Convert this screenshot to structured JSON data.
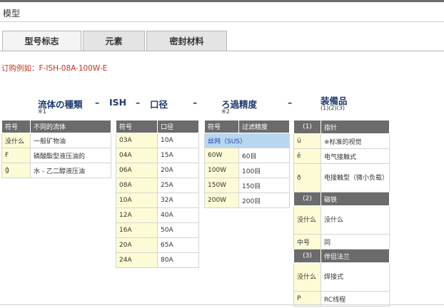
{
  "section_title": "模型",
  "tabs": [
    {
      "label": "型号标志",
      "active": true
    },
    {
      "label": "元素",
      "active": false
    },
    {
      "label": "密封材料",
      "active": false
    }
  ],
  "example": "订购例如：F-ISH-08A-100W-E",
  "code_row": {
    "fluid": "流体の種類",
    "dash1": "–",
    "ish": "ISH",
    "dash2": "–",
    "bore": "口径",
    "dash3": "–",
    "filtration": "ろ過精度",
    "dash4": "–",
    "accessory": "装備品",
    "note1": "※1",
    "note2": "※2",
    "note3": "(1)(2)(3)"
  },
  "fluid_table": {
    "headers": [
      "符号",
      "不同的流体"
    ],
    "rows": [
      [
        "没什么",
        "一般矿物油"
      ],
      [
        "F",
        "磷酸酯型液压油的"
      ],
      [
        "ĝ",
        "水 - 乙二醇液压油"
      ]
    ]
  },
  "bore_table": {
    "headers": [
      "符号",
      "口径"
    ],
    "rows": [
      [
        "03A",
        "10A"
      ],
      [
        "04A",
        "15A"
      ],
      [
        "06A",
        "20A"
      ],
      [
        "08A",
        "25A"
      ],
      [
        "10A",
        "32A"
      ],
      [
        "12A",
        "40A"
      ],
      [
        "16A",
        "50A"
      ],
      [
        "20A",
        "65A"
      ],
      [
        "24A",
        "80A"
      ]
    ]
  },
  "filter_table": {
    "headers": [
      "符号",
      "过滤精度"
    ],
    "highlight_row": "丝网（SUS）",
    "rows": [
      [
        "60W",
        "60目"
      ],
      [
        "100W",
        "100目"
      ],
      [
        "150W",
        "150目"
      ],
      [
        "200W",
        "200目"
      ]
    ]
  },
  "accessory_table": {
    "groups": [
      {
        "num": "(1)",
        "title": "指针",
        "rows": [
          [
            "ü",
            "※标准的视觉"
          ],
          [
            "ê",
            "电气接触式"
          ],
          [
            "ð",
            "电接触型（微小负载）"
          ]
        ]
      },
      {
        "num": "(2)",
        "title": "磁铁",
        "rows": [
          [
            "没什么",
            "没什么"
          ],
          [
            "中号",
            "同"
          ]
        ]
      },
      {
        "num": "(3)",
        "title": "伴侣法兰",
        "rows": [
          [
            "没什么",
            "焊接式"
          ],
          [
            "P",
            "RC线程"
          ]
        ]
      }
    ]
  },
  "colors": {
    "header_bg": "#6b6b6b",
    "code_cell_bg": "#fdfbd6",
    "highlight_row_bg": "#b8d6f0",
    "example_text": "#c0341c",
    "code_title": "#1f3a6e"
  }
}
